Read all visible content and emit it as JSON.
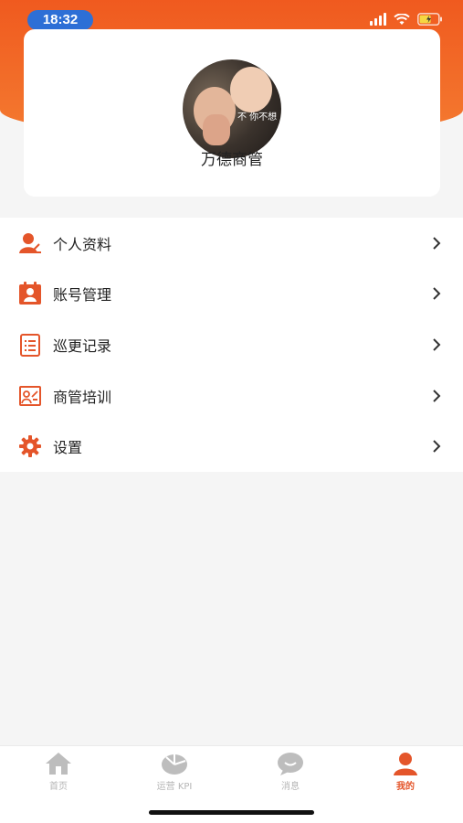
{
  "status_bar": {
    "time": "18:32"
  },
  "profile": {
    "name": "万德商管",
    "avatar_caption": "不 你不想"
  },
  "menu": {
    "items": [
      {
        "label": "个人资料",
        "icon": "person-icon"
      },
      {
        "label": "账号管理",
        "icon": "account-card-icon"
      },
      {
        "label": "巡更记录",
        "icon": "checklist-icon"
      },
      {
        "label": "商管培训",
        "icon": "training-icon"
      },
      {
        "label": "设置",
        "icon": "gear-icon"
      }
    ]
  },
  "tabbar": {
    "tabs": [
      {
        "label": "首页",
        "icon": "home-icon",
        "active": false
      },
      {
        "label": "运营 KPI",
        "icon": "pie-chart-icon",
        "active": false
      },
      {
        "label": "消息",
        "icon": "chat-bubble-icon",
        "active": false
      },
      {
        "label": "我的",
        "icon": "user-icon",
        "active": true
      }
    ]
  },
  "colors": {
    "accent": "#e4552a",
    "header": "#f05a1f",
    "inactive": "#b5b5b5"
  }
}
